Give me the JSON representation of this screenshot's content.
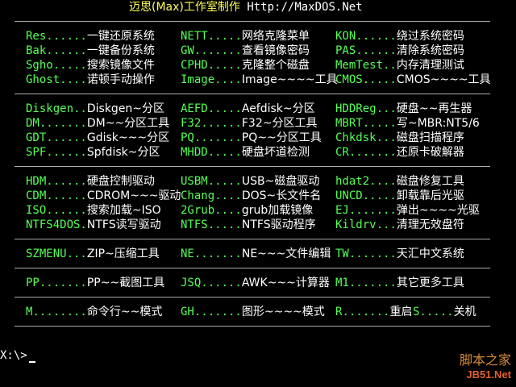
{
  "header": {
    "title_cn": "迈思(Max)工作室制作",
    "url": "Http://MaxDOS.Net"
  },
  "groups": [
    {
      "rows": [
        [
          {
            "key": "Res......",
            "desc": "一键还原系统"
          },
          {
            "key": "NETT.....",
            "desc": "网络克隆菜单"
          },
          {
            "key": "KON......",
            "desc": "绕过系统密码"
          }
        ],
        [
          {
            "key": "Bak......",
            "desc": "一键备份系统"
          },
          {
            "key": "GW.......",
            "desc": "查看镜像密码"
          },
          {
            "key": "PAS......",
            "desc": "清除系统密码"
          }
        ],
        [
          {
            "key": "Sgho.....",
            "desc": "搜索镜像文件"
          },
          {
            "key": "CPHD.....",
            "desc": "克隆整个磁盘"
          },
          {
            "key": "MemTest..",
            "desc": "内存清理测试"
          }
        ],
        [
          {
            "key": "Ghost....",
            "desc": "诺顿手动操作"
          },
          {
            "key": "Image....",
            "desc": "Image~~~~工具"
          },
          {
            "key": "CMOS.....",
            "desc": "CMOS~~~~工具"
          }
        ]
      ]
    },
    {
      "rows": [
        [
          {
            "key": "Diskgen..",
            "desc": "Diskgen~分区"
          },
          {
            "key": "AEFD.....",
            "desc": "Aefdisk~分区"
          },
          {
            "key": "HDDReg...",
            "desc": "硬盘~~再生器"
          }
        ],
        [
          {
            "key": "DM.......",
            "desc": "DM~~分区工具"
          },
          {
            "key": "F32......",
            "desc": "F32~分区工具"
          },
          {
            "key": "MBRT.....",
            "desc": "写~MBR:NT5/6"
          }
        ],
        [
          {
            "key": "GDT......",
            "desc": "Gdisk~~~分区"
          },
          {
            "key": "PQ.......",
            "desc": "PQ~~分区工具"
          },
          {
            "key": "Chkdsk...",
            "desc": "磁盘扫描程序"
          }
        ],
        [
          {
            "key": "SPF......",
            "desc": "Spfdisk~分区"
          },
          {
            "key": "MHDD.....",
            "desc": "硬盘坏道检测"
          },
          {
            "key": "CR.......",
            "desc": "还原卡破解器"
          }
        ]
      ]
    },
    {
      "rows": [
        [
          {
            "key": "HDM......",
            "desc": "硬盘控制驱动"
          },
          {
            "key": "USBM.....",
            "desc": "USB~磁盘驱动"
          },
          {
            "key": "hdat2....",
            "desc": "磁盘修复工具"
          }
        ],
        [
          {
            "key": "CDM......",
            "desc": "CDROM~~~驱动"
          },
          {
            "key": "Chang....",
            "desc": "DOS~长文件名"
          },
          {
            "key": "UNCD.....",
            "desc": "卸载靠后光驱"
          }
        ],
        [
          {
            "key": "ISO......",
            "desc": "搜索加载~ISO"
          },
          {
            "key": "2Grub....",
            "desc": "grub加载镜像"
          },
          {
            "key": "EJ.......",
            "desc": "弹出~~~~光驱"
          }
        ],
        [
          {
            "key": "NTFS4DOS.",
            "desc": "NTFS读写驱动"
          },
          {
            "key": "NTFS.....",
            "desc": "NTFS驱动程序"
          },
          {
            "key": "Kildrv...",
            "desc": "清理无效盘符"
          }
        ]
      ]
    },
    {
      "rows": [
        [
          {
            "key": "SZMENU...",
            "desc": "ZIP~压缩工具"
          },
          {
            "key": "NE.......",
            "desc": "NE~~~文件编辑"
          },
          {
            "key": "TW.......",
            "desc": "天汇中文系统"
          }
        ]
      ]
    },
    {
      "rows": [
        [
          {
            "key": "PP.......",
            "desc": "PP~~截图工具"
          },
          {
            "key": "JSQ......",
            "desc": "AWK~~~计算器"
          },
          {
            "key": "M1.......",
            "desc": "其它更多工具"
          }
        ]
      ]
    },
    {
      "rows": [
        [
          {
            "key": "M........",
            "desc": "命令行~~模式"
          },
          {
            "key": "GH.......",
            "desc": "图形~~~~模式"
          },
          {
            "key": "R.......",
            "desc": "重启"
          },
          {
            "key": "S.....",
            "desc": "关机"
          }
        ]
      ]
    }
  ],
  "prompt": "X:\\>",
  "watermark": {
    "line1": "脚本之家",
    "line2": "JB51.Net"
  }
}
